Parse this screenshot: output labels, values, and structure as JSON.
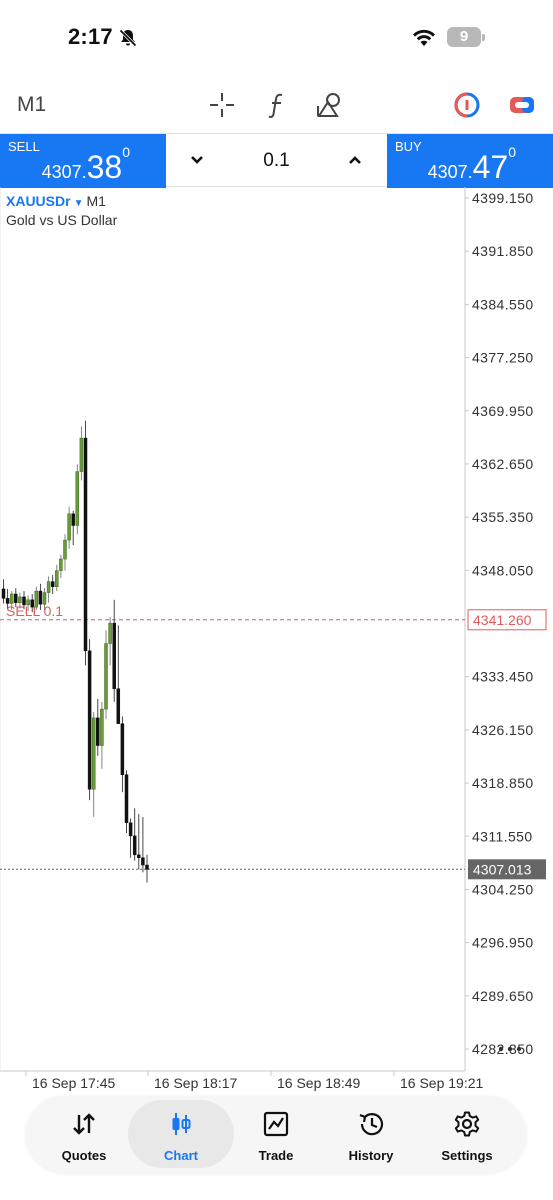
{
  "status_bar": {
    "time": "2:17",
    "battery": "9"
  },
  "toolbar": {
    "timeframe": "M1"
  },
  "trade": {
    "sell_label": "SELL",
    "sell_price_prefix": "4307.",
    "sell_price_big": "38",
    "sell_price_sup": "0",
    "buy_label": "BUY",
    "buy_price_prefix": "4307.",
    "buy_price_big": "47",
    "buy_price_sup": "0",
    "volume": "0.1"
  },
  "chart": {
    "symbol": "XAUUSDr",
    "symbol_arrow": "▼",
    "timeframe": "M1",
    "description": "Gold vs US Dollar",
    "position_label": "SELL 0.1",
    "colors": {
      "bull": "#6a9a3a",
      "bear": "#111111",
      "sell_line": "#e35a5a",
      "accent": "#1877f2"
    }
  },
  "chart_data": {
    "type": "candlestick",
    "y_ticks": [
      "4399.150",
      "4391.850",
      "4384.550",
      "4377.250",
      "4369.950",
      "4362.650",
      "4355.350",
      "4348.050",
      "4333.450",
      "4326.150",
      "4318.850",
      "4311.550",
      "4304.250",
      "4296.950",
      "4289.650",
      "4282.350"
    ],
    "ylim": [
      4277.0,
      4402.0
    ],
    "x_ticks": [
      "16 Sep 17:45",
      "16 Sep 18:17",
      "16 Sep 18:49",
      "16 Sep 19:21"
    ],
    "sell_line_value": 4341.26,
    "sell_line_label": "4341.260",
    "current_price": 4307.013,
    "current_price_label": "4307.013",
    "candles": [
      [
        4345.5,
        4346.8,
        4343.5,
        4344.2
      ],
      [
        4344.2,
        4345.5,
        4342.8,
        4343.5
      ],
      [
        4343.5,
        4345.2,
        4342.6,
        4344.8
      ],
      [
        4344.8,
        4345.6,
        4343.0,
        4343.6
      ],
      [
        4343.6,
        4345.0,
        4342.8,
        4344.4
      ],
      [
        4344.4,
        4345.2,
        4342.7,
        4343.3
      ],
      [
        4343.3,
        4344.6,
        4342.5,
        4344.0
      ],
      [
        4344.0,
        4344.8,
        4342.3,
        4343.0
      ],
      [
        4343.0,
        4345.8,
        4342.6,
        4345.2
      ],
      [
        4345.2,
        4346.2,
        4342.6,
        4343.4
      ],
      [
        4343.4,
        4345.6,
        4342.6,
        4345.0
      ],
      [
        4345.0,
        4347.2,
        4343.6,
        4346.5
      ],
      [
        4346.5,
        4347.4,
        4344.8,
        4345.8
      ],
      [
        4345.8,
        4348.8,
        4345.2,
        4348.0
      ],
      [
        4348.0,
        4350.2,
        4347.0,
        4349.6
      ],
      [
        4349.6,
        4353.0,
        4348.0,
        4352.2
      ],
      [
        4352.2,
        4356.8,
        4351.0,
        4355.8
      ],
      [
        4355.8,
        4356.2,
        4351.5,
        4354.2
      ],
      [
        4354.2,
        4362.6,
        4353.0,
        4361.6
      ],
      [
        4361.6,
        4367.8,
        4360.4,
        4366.2
      ],
      [
        4366.2,
        4368.6,
        4335.0,
        4337.0
      ],
      [
        4337.0,
        4338.6,
        4316.5,
        4318.0
      ],
      [
        4318.0,
        4328.6,
        4314.2,
        4327.8
      ],
      [
        4327.8,
        4330.4,
        4322.6,
        4324.0
      ],
      [
        4324.0,
        4330.0,
        4320.8,
        4329.0
      ],
      [
        4329.0,
        4339.8,
        4327.6,
        4338.0
      ],
      [
        4338.0,
        4341.6,
        4335.0,
        4340.8
      ],
      [
        4340.8,
        4344.0,
        4330.0,
        4331.8
      ],
      [
        4331.8,
        4340.5,
        4328.6,
        4327.0
      ],
      [
        4327.0,
        4328.0,
        4317.6,
        4320.0
      ],
      [
        4320.0,
        4320.6,
        4312.0,
        4313.4
      ],
      [
        4313.4,
        4314.0,
        4308.6,
        4311.6
      ],
      [
        4311.6,
        4315.4,
        4308.2,
        4309.0
      ],
      [
        4309.0,
        4314.6,
        4307.0,
        4308.6
      ],
      [
        4308.6,
        4314.2,
        4306.6,
        4307.6
      ],
      [
        4307.6,
        4309.0,
        4305.2,
        4307.0
      ]
    ]
  },
  "nav": {
    "items": [
      {
        "label": "Quotes"
      },
      {
        "label": "Chart"
      },
      {
        "label": "Trade"
      },
      {
        "label": "History"
      },
      {
        "label": "Settings"
      }
    ]
  }
}
